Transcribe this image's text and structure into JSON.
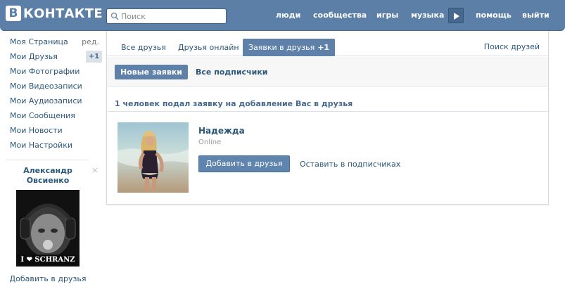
{
  "header": {
    "logo_letter": "В",
    "logo_text": "КОНТАКТЕ",
    "search_placeholder": "Поиск",
    "nav": {
      "people": "люди",
      "communities": "сообщества",
      "games": "игры",
      "music": "музыка",
      "help": "помощь",
      "logout": "выйти"
    }
  },
  "sidebar": {
    "items": [
      {
        "label": "Моя Страница",
        "extra": "ред."
      },
      {
        "label": "Мои Друзья",
        "badge": "+1"
      },
      {
        "label": "Мои Фотографии"
      },
      {
        "label": "Мои Видеозаписи"
      },
      {
        "label": "Мои Аудиозаписи"
      },
      {
        "label": "Мои Сообщения"
      },
      {
        "label": "Мои Новости"
      },
      {
        "label": "Мои Настройки"
      }
    ],
    "suggestion": {
      "name": "Александр\nОвсиенко",
      "close_icon": "×",
      "photo_caption": "I ❤ SCHRANZ",
      "add_label": "Добавить в друзья"
    }
  },
  "main": {
    "tabs": {
      "all": "Все друзья",
      "online": "Друзья онлайн",
      "requests": "Заявки в друзья",
      "requests_count": "+1",
      "find": "Поиск друзей"
    },
    "subtabs": {
      "new": "Новые заявки",
      "subscribers": "Все подписчики"
    },
    "summary": "1 человек подал заявку на добавление Вас в друзья",
    "request": {
      "name": "Надежда",
      "status": "Online",
      "add_label": "Добавить в друзья",
      "keep_label": "Оставить в подписчиках"
    }
  },
  "colors": {
    "header_bg": "#5b7fa6",
    "accent": "#5e80a9",
    "link": "#2b587a"
  }
}
